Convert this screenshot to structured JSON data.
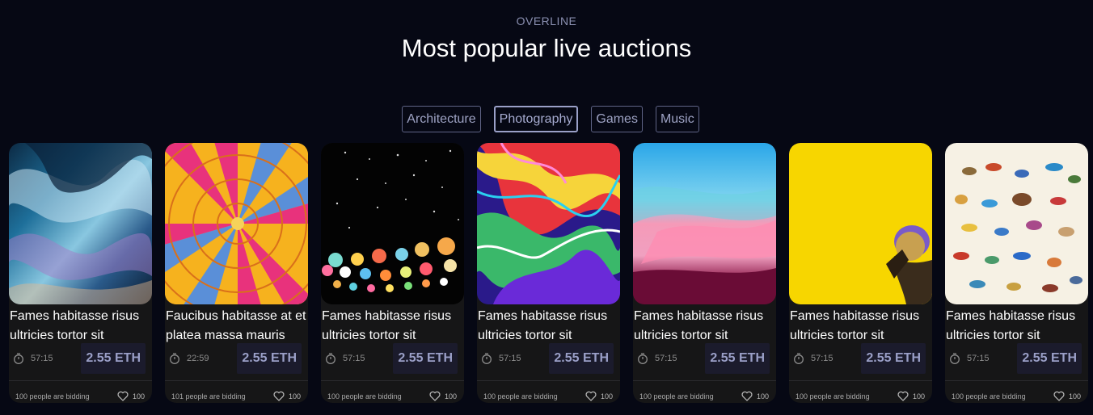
{
  "header": {
    "overline": "OVERLINE",
    "title": "Most popular live auctions"
  },
  "filters": [
    {
      "label": "Architecture",
      "active": false
    },
    {
      "label": "Photography",
      "active": true
    },
    {
      "label": "Games",
      "active": false
    },
    {
      "label": "Music",
      "active": false
    }
  ],
  "cards": [
    {
      "image": "iridescent-abstract",
      "title": "Fames habitasse risus ultricies tortor sit",
      "time": "57:15",
      "price": "2.55 ETH",
      "bidding": "100 people are bidding",
      "likes": "100"
    },
    {
      "image": "hot-air-balloon",
      "title": "Faucibus habitasse at et platea massa mauris",
      "time": "22:59",
      "price": "2.55 ETH",
      "bidding": "101 people are bidding",
      "likes": "100"
    },
    {
      "image": "night-lanterns",
      "title": "Fames habitasse risus ultricies tortor sit",
      "time": "57:15",
      "price": "2.55 ETH",
      "bidding": "100 people are bidding",
      "likes": "100"
    },
    {
      "image": "psychedelic-marble",
      "title": "Fames habitasse risus ultricies tortor sit",
      "time": "57:15",
      "price": "2.55 ETH",
      "bidding": "100 people are bidding",
      "likes": "100"
    },
    {
      "image": "pastel-sky-paint",
      "title": "Fames habitasse risus ultricies tortor sit",
      "time": "57:15",
      "price": "2.55 ETH",
      "bidding": "100 people are bidding",
      "likes": "100"
    },
    {
      "image": "yellow-wall-figure",
      "title": "Fames habitasse risus ultricies tortor sit",
      "time": "57:15",
      "price": "2.55 ETH",
      "bidding": "100 people are bidding",
      "likes": "100"
    },
    {
      "image": "bird-illustrations",
      "title": "Fames habitasse risus ultricies tortor sit",
      "time": "57:15",
      "price": "2.55 ETH",
      "bidding": "100 people are bidding",
      "likes": "100"
    }
  ]
}
